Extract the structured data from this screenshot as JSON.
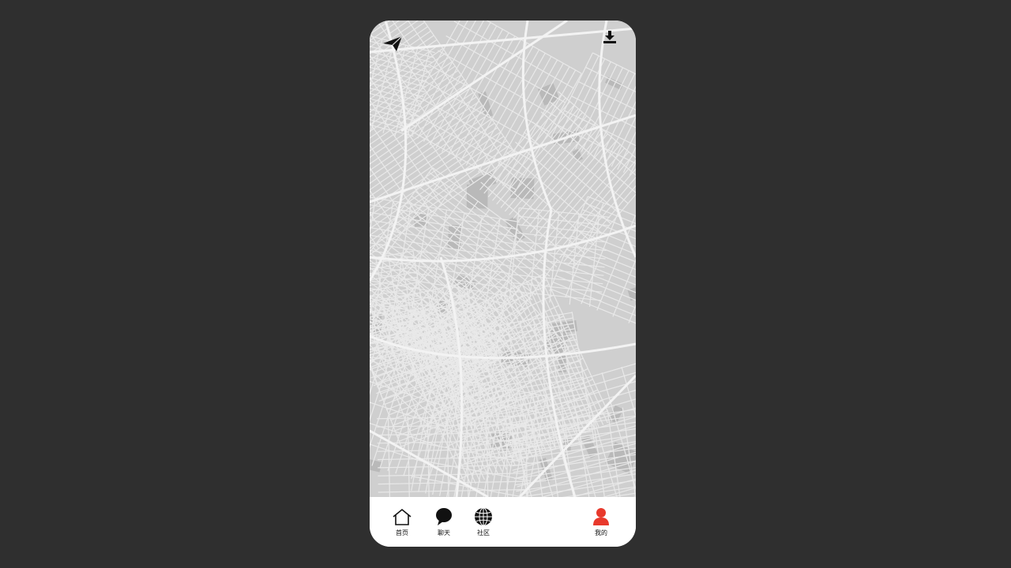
{
  "screen": {
    "background_color": "#2f2f2f",
    "map_base_color": "#cfcfcf",
    "road_color": "#ececec",
    "block_color": "#b7b7b7"
  },
  "top_bar": {
    "left_icon": "paper-plane-icon",
    "right_icon": "download-icon"
  },
  "tabbar": {
    "items": [
      {
        "label": "首页",
        "icon": "home-icon",
        "active": false
      },
      {
        "label": "聊天",
        "icon": "chat-bubble-icon",
        "active": false
      },
      {
        "label": "社区",
        "icon": "globe-icon",
        "active": false
      },
      {
        "label": "我的",
        "icon": "user-icon",
        "active": true
      }
    ],
    "active_color": "#e8392c",
    "inactive_color": "#111111"
  }
}
